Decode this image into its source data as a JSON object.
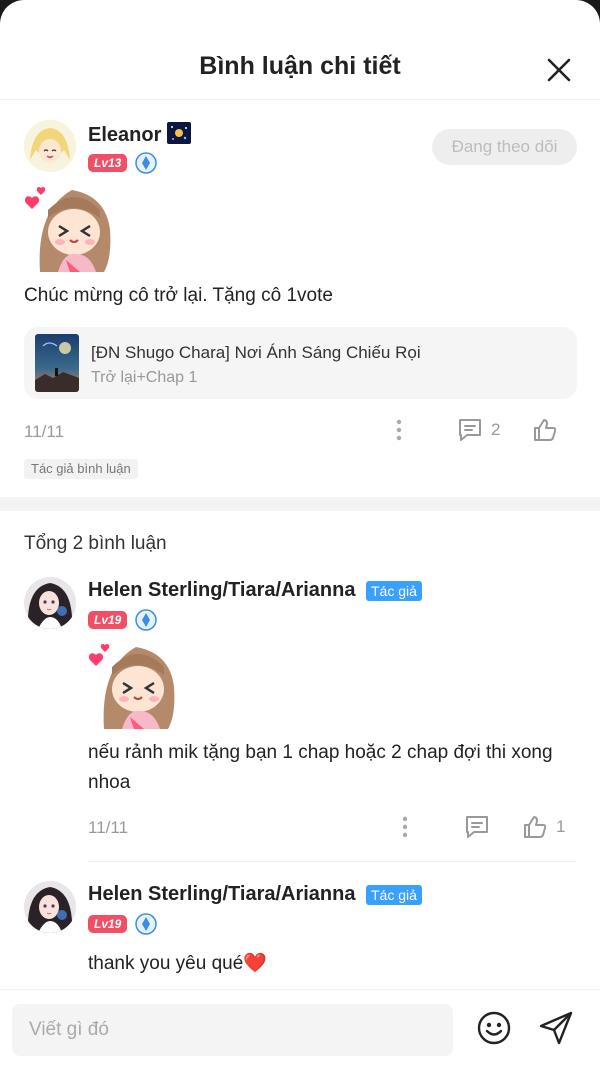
{
  "header": {
    "title": "Bình luận chi tiết"
  },
  "main_comment": {
    "username": "Eleanor",
    "level": "Lv13",
    "follow_label": "Đang theo dõi",
    "text": "Chúc mừng cô trở lại. Tặng cô 1vote",
    "book": {
      "title": "[ĐN Shugo Chara] Nơi Ánh Sáng Chiếu Rọi",
      "chapter": "Trở lại+Chap 1"
    },
    "date": "11/11",
    "reply_count": "2",
    "tag": "Tác giả bình luận"
  },
  "replies_summary": "Tổng 2 bình luận",
  "replies": [
    {
      "username": "Helen Sterling/Tiara/Arianna",
      "author_tag": "Tác giả",
      "level": "Lv19",
      "text": "nếu rảnh mik tặng bạn 1 chap hoặc 2 chap đợi thi xong nhoa",
      "date": "11/11",
      "like_count": "1"
    },
    {
      "username": "Helen Sterling/Tiara/Arianna",
      "author_tag": "Tác giả",
      "level": "Lv19",
      "text": "thank you yêu qué❤️"
    }
  ],
  "composer": {
    "placeholder": "Viết gì đó"
  },
  "colors": {
    "level_badge": "#f04f66",
    "author_tag": "#3aa0ff",
    "medal": "#3a8ee6"
  }
}
